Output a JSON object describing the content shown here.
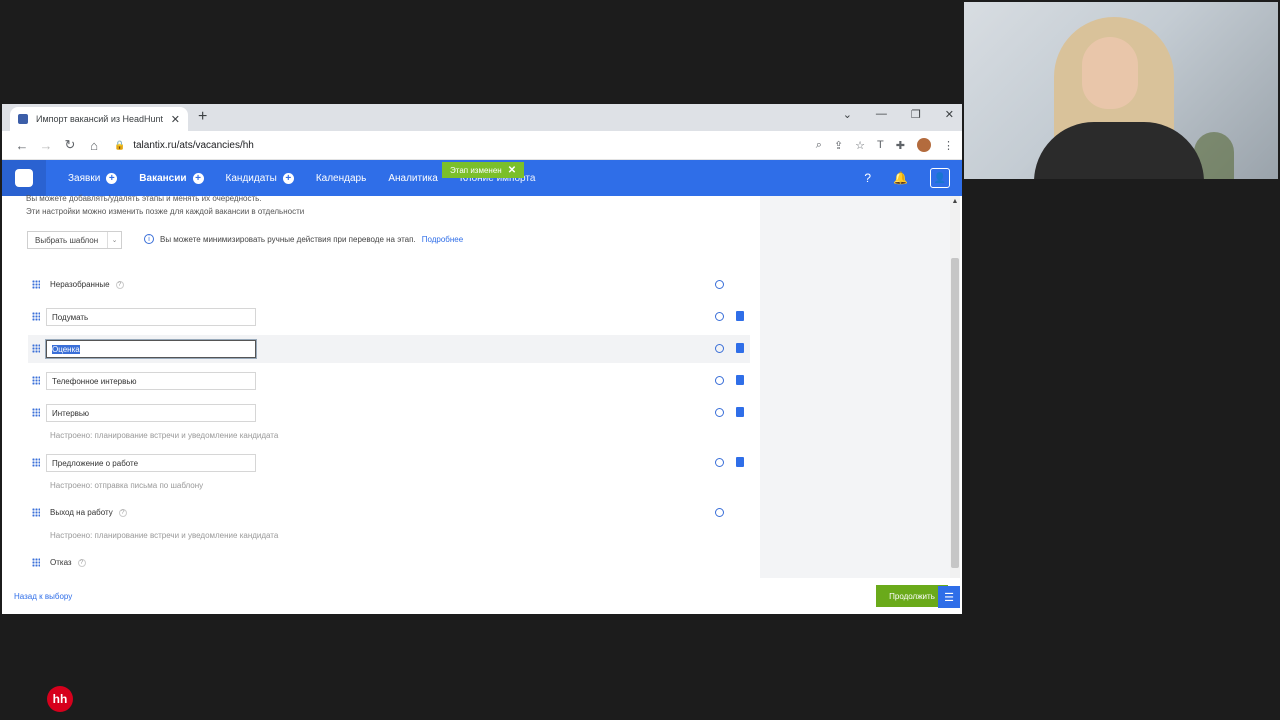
{
  "browser": {
    "tab_title": "Импорт вакансий из HeadHunt",
    "new_tab_label": "+",
    "url": "talantix.ru/ats/vacancies/hh",
    "window_controls": [
      "⌄",
      "—",
      "❐",
      "✕"
    ]
  },
  "appbar": {
    "nav": [
      {
        "label": "Заявки",
        "has_plus": true
      },
      {
        "label": "Вакансии",
        "has_plus": true,
        "active": true
      },
      {
        "label": "Кандидаты",
        "has_plus": true
      },
      {
        "label": "Календарь"
      },
      {
        "label": "Аналитика"
      },
      {
        "label": "Клоние импорта"
      }
    ],
    "toast": "Этап изменен",
    "toast_close": "✕"
  },
  "content": {
    "intro_line1": "Вы можете добавлять/удалять этапы и менять их очередность.",
    "intro_line2": "Эти настройки можно изменить позже для каждой вакансии в отдельности",
    "template_select": "Выбрать шаблон",
    "info_text": "Вы можете минимизировать ручные действия при переводе на этап.",
    "info_link": "Подробнее",
    "stages": [
      {
        "label": "Неразобранные",
        "editable": false
      },
      {
        "value": "Подумать",
        "editable": true
      },
      {
        "value": "Оценка",
        "editable": true,
        "focused": true
      },
      {
        "value": "Телефонное интервью",
        "editable": true
      },
      {
        "value": "Интервью",
        "editable": true,
        "note": "Настроено: планирование встречи и уведомление кандидата"
      },
      {
        "value": "Предложение о работе",
        "editable": true,
        "note": "Настроено: отправка письма по шаблону"
      },
      {
        "label": "Выход на работу",
        "editable": false,
        "note": "Настроено: планирование встречи и уведомление кандидата"
      },
      {
        "label": "Отказ",
        "editable": false
      }
    ],
    "back_link": "Назад к выбору",
    "continue_button": "Продолжить"
  },
  "overlay": {
    "hh_logo": "hh"
  },
  "colors": {
    "accent": "#2f6ee8",
    "success": "#6aaa1a",
    "hh_red": "#d6001c"
  }
}
